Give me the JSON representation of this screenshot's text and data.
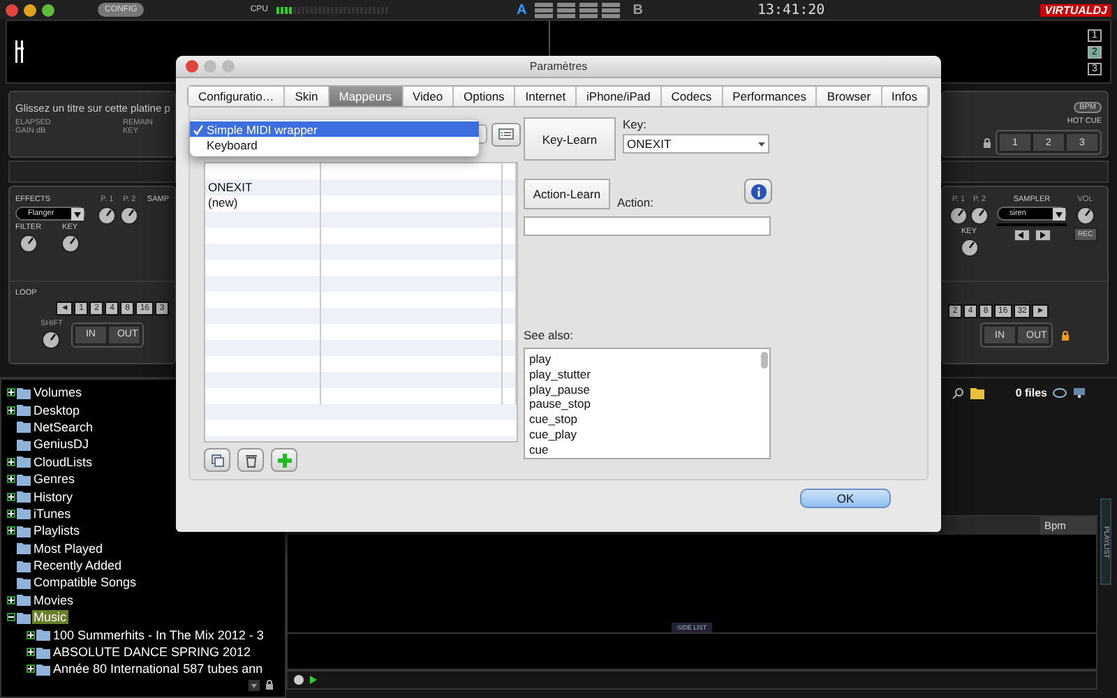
{
  "top_bar": {
    "config_button": "CONFIG",
    "cpu_label": "CPU",
    "cpu_meter": {
      "level": 0.15
    },
    "deck_a": "A",
    "deck_b": "B",
    "clock": "13:41:20",
    "logo": "VIRTUALDJ"
  },
  "deck_numbers": [
    {
      "label": "1",
      "selected": false
    },
    {
      "label": "2",
      "selected": true
    },
    {
      "label": "3",
      "selected": false
    }
  ],
  "left_deck": {
    "drop_hint": "Glissez un titre sur cette platine p",
    "info_labels": [
      "ELAPSED",
      "REMAIN",
      "GAIN dB",
      "KEY"
    ],
    "effects_label": "EFFECTS",
    "effect": "Flanger",
    "p1": "P. 1",
    "p2": "P. 2",
    "filter": "FILTER",
    "key": "KEY",
    "sampler_label": "SAMP",
    "loop_label": "LOOP",
    "loop_buttons": [
      "◄",
      "1",
      "2",
      "4",
      "8",
      "16",
      "3"
    ],
    "shift": "SHIFT",
    "in": "IN",
    "out": "OUT"
  },
  "right_deck": {
    "bpm": "BPM",
    "hot_cue_label": "HOT CUE",
    "hot_cues": [
      "1",
      "2",
      "3"
    ],
    "p1": "P. 1",
    "p2": "P. 2",
    "key": "KEY",
    "sampler_label": "SAMPLER",
    "sample": "siren",
    "vol": "VOL",
    "rec": "REC",
    "loop_buttons": [
      "2",
      "4",
      "8",
      "16",
      "32",
      "►"
    ],
    "in": "IN",
    "out": "OUT"
  },
  "browser": {
    "tree": [
      {
        "label": "Volumes",
        "kind": "group",
        "expanded": false,
        "selected": false
      },
      {
        "label": "Desktop",
        "kind": "group",
        "expanded": false,
        "selected": false
      },
      {
        "label": "NetSearch",
        "kind": "item",
        "selected": false
      },
      {
        "label": "GeniusDJ",
        "kind": "item",
        "selected": false
      },
      {
        "label": "CloudLists",
        "kind": "group",
        "expanded": false,
        "selected": false
      },
      {
        "label": "Genres",
        "kind": "group",
        "expanded": false,
        "selected": false
      },
      {
        "label": "History",
        "kind": "group",
        "expanded": false,
        "selected": false
      },
      {
        "label": "iTunes",
        "kind": "group",
        "expanded": false,
        "selected": false
      },
      {
        "label": "Playlists",
        "kind": "group",
        "expanded": false,
        "selected": false
      },
      {
        "label": "Most Played",
        "kind": "item",
        "selected": false
      },
      {
        "label": "Recently Added",
        "kind": "item",
        "selected": false
      },
      {
        "label": "Compatible Songs",
        "kind": "item",
        "selected": false
      },
      {
        "label": "Movies",
        "kind": "group",
        "expanded": false,
        "selected": false
      },
      {
        "label": "Music",
        "kind": "group",
        "expanded": true,
        "selected": true,
        "children": [
          {
            "label": "100 Summerhits - In The Mix 2012 - 3",
            "kind": "group",
            "expanded": false,
            "selected": false
          },
          {
            "label": "ABSOLUTE DANCE SPRING 2012",
            "kind": "group",
            "expanded": false,
            "selected": false
          },
          {
            "label": "Année 80 International 587 tubes ann",
            "kind": "group",
            "expanded": false,
            "selected": false
          }
        ]
      }
    ],
    "file_count": "0 files",
    "columns": [
      "Bpm"
    ],
    "side_list": "SIDE LIST",
    "playlist_tab": "PLAYLIST"
  },
  "dialog": {
    "title": "Paramètres",
    "tabs": [
      {
        "label": "Configuratio…",
        "selected": false
      },
      {
        "label": "Skin",
        "selected": false
      },
      {
        "label": "Mappeurs",
        "selected": true
      },
      {
        "label": "Video",
        "selected": false
      },
      {
        "label": "Options",
        "selected": false
      },
      {
        "label": "Internet",
        "selected": false
      },
      {
        "label": "iPhone/iPad",
        "selected": false
      },
      {
        "label": "Codecs",
        "selected": false
      },
      {
        "label": "Performances",
        "selected": false
      },
      {
        "label": "Browser",
        "selected": false
      },
      {
        "label": "Infos",
        "selected": false
      }
    ],
    "mapper_menu": [
      {
        "label": "Simple MIDI wrapper",
        "checked": true,
        "selected": true
      },
      {
        "label": "Keyboard",
        "checked": false,
        "selected": false
      }
    ],
    "mappings": [
      {
        "key": "ONEXIT"
      },
      {
        "key": "(new)"
      }
    ],
    "key_learn": "Key-Learn",
    "key_label": "Key:",
    "key_value": "ONEXIT",
    "action_learn": "Action-Learn",
    "action_label": "Action:",
    "see_also_label": "See also:",
    "see_also": [
      "play",
      "play_stutter",
      "play_pause",
      "pause_stop",
      "cue_stop",
      "cue_play",
      "cue"
    ],
    "ok": "OK"
  }
}
